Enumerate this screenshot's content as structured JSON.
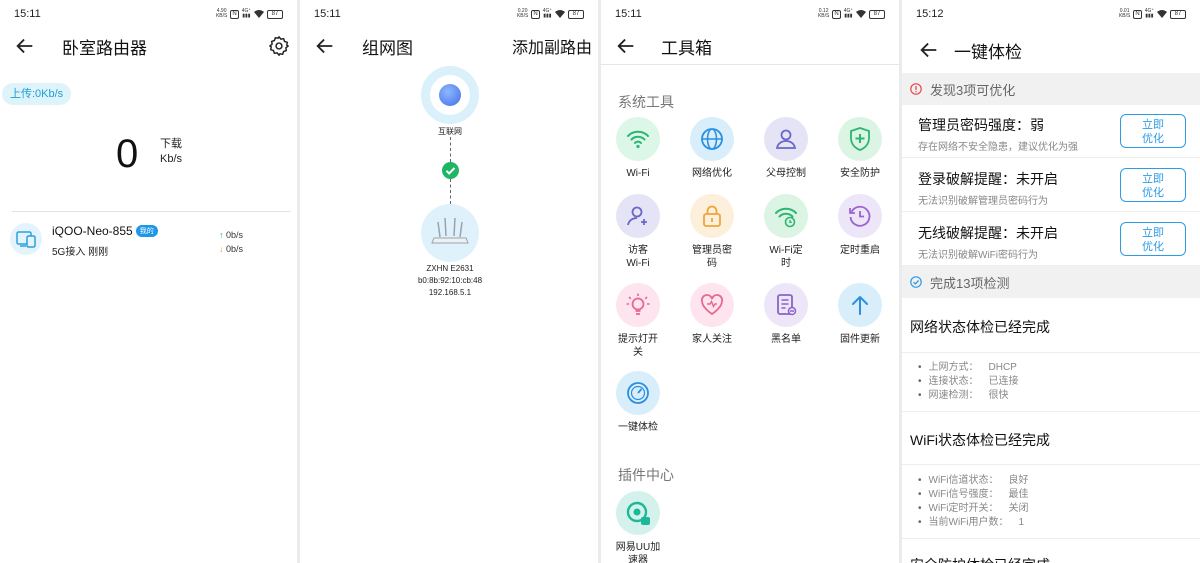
{
  "panel1": {
    "time": "15:11",
    "title": "卧室路由器",
    "upload_badge": "上传:0Kb/s",
    "download_value": "0",
    "download_label": "下载",
    "download_unit": "Kb/s",
    "device": {
      "name": "iQOO-Neo-855",
      "tag": "我的",
      "sub": "5G接入 刚刚",
      "up_rate": "0b/s",
      "down_rate": "0b/s"
    }
  },
  "panel2": {
    "time": "15:11",
    "title": "组网图",
    "action": "添加副路由",
    "internet_label": "互联网",
    "router_model": "ZXHN E2631",
    "router_mac": "b0:8b:92:10:cb:48",
    "router_ip": "192.168.5.1"
  },
  "panel3": {
    "time": "15:11",
    "title": "工具箱",
    "section_tools": "系统工具",
    "section_plugins": "插件中心",
    "tools": [
      {
        "label": "Wi-Fi",
        "icon": "wifi-icon"
      },
      {
        "label": "网络优化",
        "icon": "globe-icon"
      },
      {
        "label": "父母控制",
        "icon": "parent-icon"
      },
      {
        "label": "安全防护",
        "icon": "shield-plus-icon"
      },
      {
        "label": "访客\nWi-Fi",
        "icon": "guest-icon"
      },
      {
        "label": "管理员密\n码",
        "icon": "lock-icon"
      },
      {
        "label": "Wi-Fi定\n时",
        "icon": "wifi-timer-icon"
      },
      {
        "label": "定时重启",
        "icon": "clock-restart-icon"
      },
      {
        "label": "提示灯开\n关",
        "icon": "bulb-icon"
      },
      {
        "label": "家人关注",
        "icon": "heart-icon"
      },
      {
        "label": "黑名单",
        "icon": "blacklist-icon"
      },
      {
        "label": "固件更新",
        "icon": "upload-arrow-icon"
      },
      {
        "label": "一键体检",
        "icon": "gauge-icon"
      }
    ],
    "plugins": [
      {
        "label": "网易UU加\n速器",
        "icon": "uu-accelerator-icon"
      }
    ]
  },
  "panel4": {
    "time": "15:12",
    "title": "一键体检",
    "warn_bar": "发现3项可优化",
    "items": [
      {
        "title": "管理员密码强度：弱",
        "sub": "存在网络不安全隐患，建议优化为强",
        "button": "立即\n优化"
      },
      {
        "title": "登录破解提醒：未开启",
        "sub": "无法识别破解管理员密码行为",
        "button": "立即\n优化"
      },
      {
        "title": "无线破解提醒：未开启",
        "sub": "无法识别破解WiFi密码行为",
        "button": "立即\n优化"
      }
    ],
    "done_bar": "完成13项检测",
    "sections": [
      {
        "title": "网络状态体检已经完成",
        "rows": [
          {
            "k": "上网方式：",
            "v": "DHCP"
          },
          {
            "k": "连接状态：",
            "v": "已连接"
          },
          {
            "k": "网速检测：",
            "v": "很快"
          }
        ]
      },
      {
        "title": "WiFi状态体检已经完成",
        "rows": [
          {
            "k": "WiFi信道状态：",
            "v": "良好"
          },
          {
            "k": "WiFi信号强度：",
            "v": "最佳"
          },
          {
            "k": "WiFi定时开关：",
            "v": "关闭"
          },
          {
            "k": "当前WiFi用户数：",
            "v": "1"
          }
        ]
      },
      {
        "title": "安全防护体检已经完成",
        "rows": []
      }
    ]
  },
  "colors": {
    "accent": "#2d9be5",
    "success": "#1fb663",
    "warning": "#e5484d"
  }
}
